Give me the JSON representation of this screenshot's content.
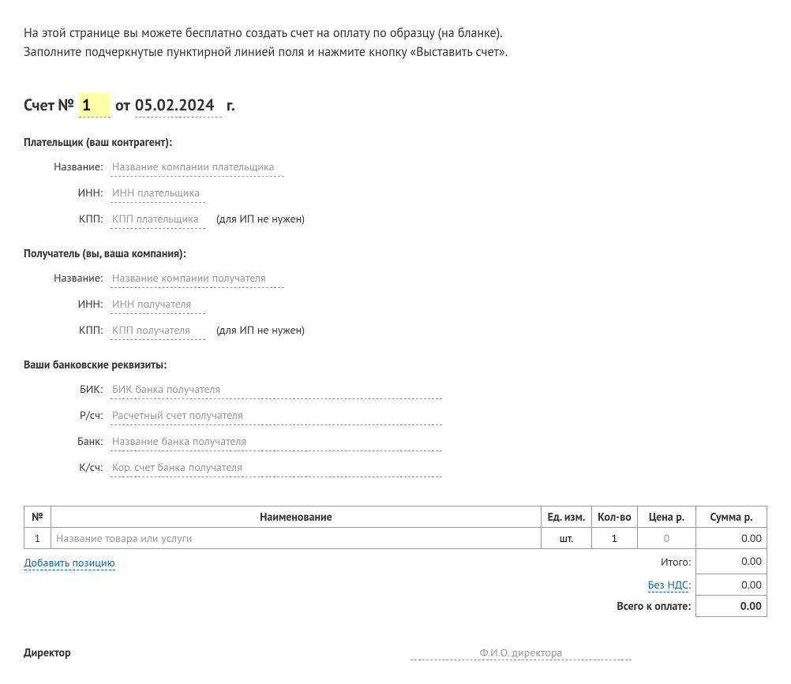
{
  "intro_line1": "На этой странице вы можете бесплатно создать счет на оплату по образцу (на бланке).",
  "intro_line2": "Заполните подчеркнутые пунктирной линией поля и нажмите кнопку «Выставить счет».",
  "header": {
    "prefix": "Счет №",
    "number": "1",
    "from_label": "от",
    "date": "05.02.2024",
    "year_suffix": "г."
  },
  "payer": {
    "section_title": "Плательщик (ваш контрагент):",
    "name_label": "Название:",
    "name_ph": "Название компании плательщика",
    "inn_label": "ИНН:",
    "inn_ph": "ИНН плательщика",
    "kpp_label": "КПП:",
    "kpp_ph": "КПП плательщика",
    "kpp_hint": "(для ИП не нужен)"
  },
  "recipient": {
    "section_title": "Получатель (вы, ваша компания):",
    "name_label": "Название:",
    "name_ph": "Название компании получателя",
    "inn_label": "ИНН:",
    "inn_ph": "ИНН получателя",
    "kpp_label": "КПП:",
    "kpp_ph": "КПП получателя",
    "kpp_hint": "(для ИП не нужен)"
  },
  "bank": {
    "section_title": "Ваши банковские реквизиты:",
    "bik_label": "БИК:",
    "bik_ph": "БИК банка получателя",
    "rs_label": "Р/сч:",
    "rs_ph": "Расчетный счет получателя",
    "bank_label": "Банк:",
    "bank_ph": "Название банка получателя",
    "ks_label": "К/сч:",
    "ks_ph": "Кор. счет банка получателя"
  },
  "table": {
    "headers": {
      "num": "№",
      "name": "Наименование",
      "unit": "Ед. изм.",
      "qty": "Кол-во",
      "price": "Цена р.",
      "sum": "Сумма р."
    },
    "rows": [
      {
        "num": "1",
        "name_ph": "Название товара или услуги",
        "unit": "шт.",
        "qty": "1",
        "price_ph": "0",
        "sum": "0.00"
      }
    ],
    "add_link": "Добавить позицию",
    "totals": {
      "subtotal_label": "Итого:",
      "subtotal": "0.00",
      "nds_label": "Без НДС",
      "nds_colon": ":",
      "nds_value": "0.00",
      "grand_label": "Всего к оплате:",
      "grand": "0.00"
    }
  },
  "director": {
    "label": "Директор",
    "fio_ph": "Ф.И.О. директора"
  }
}
